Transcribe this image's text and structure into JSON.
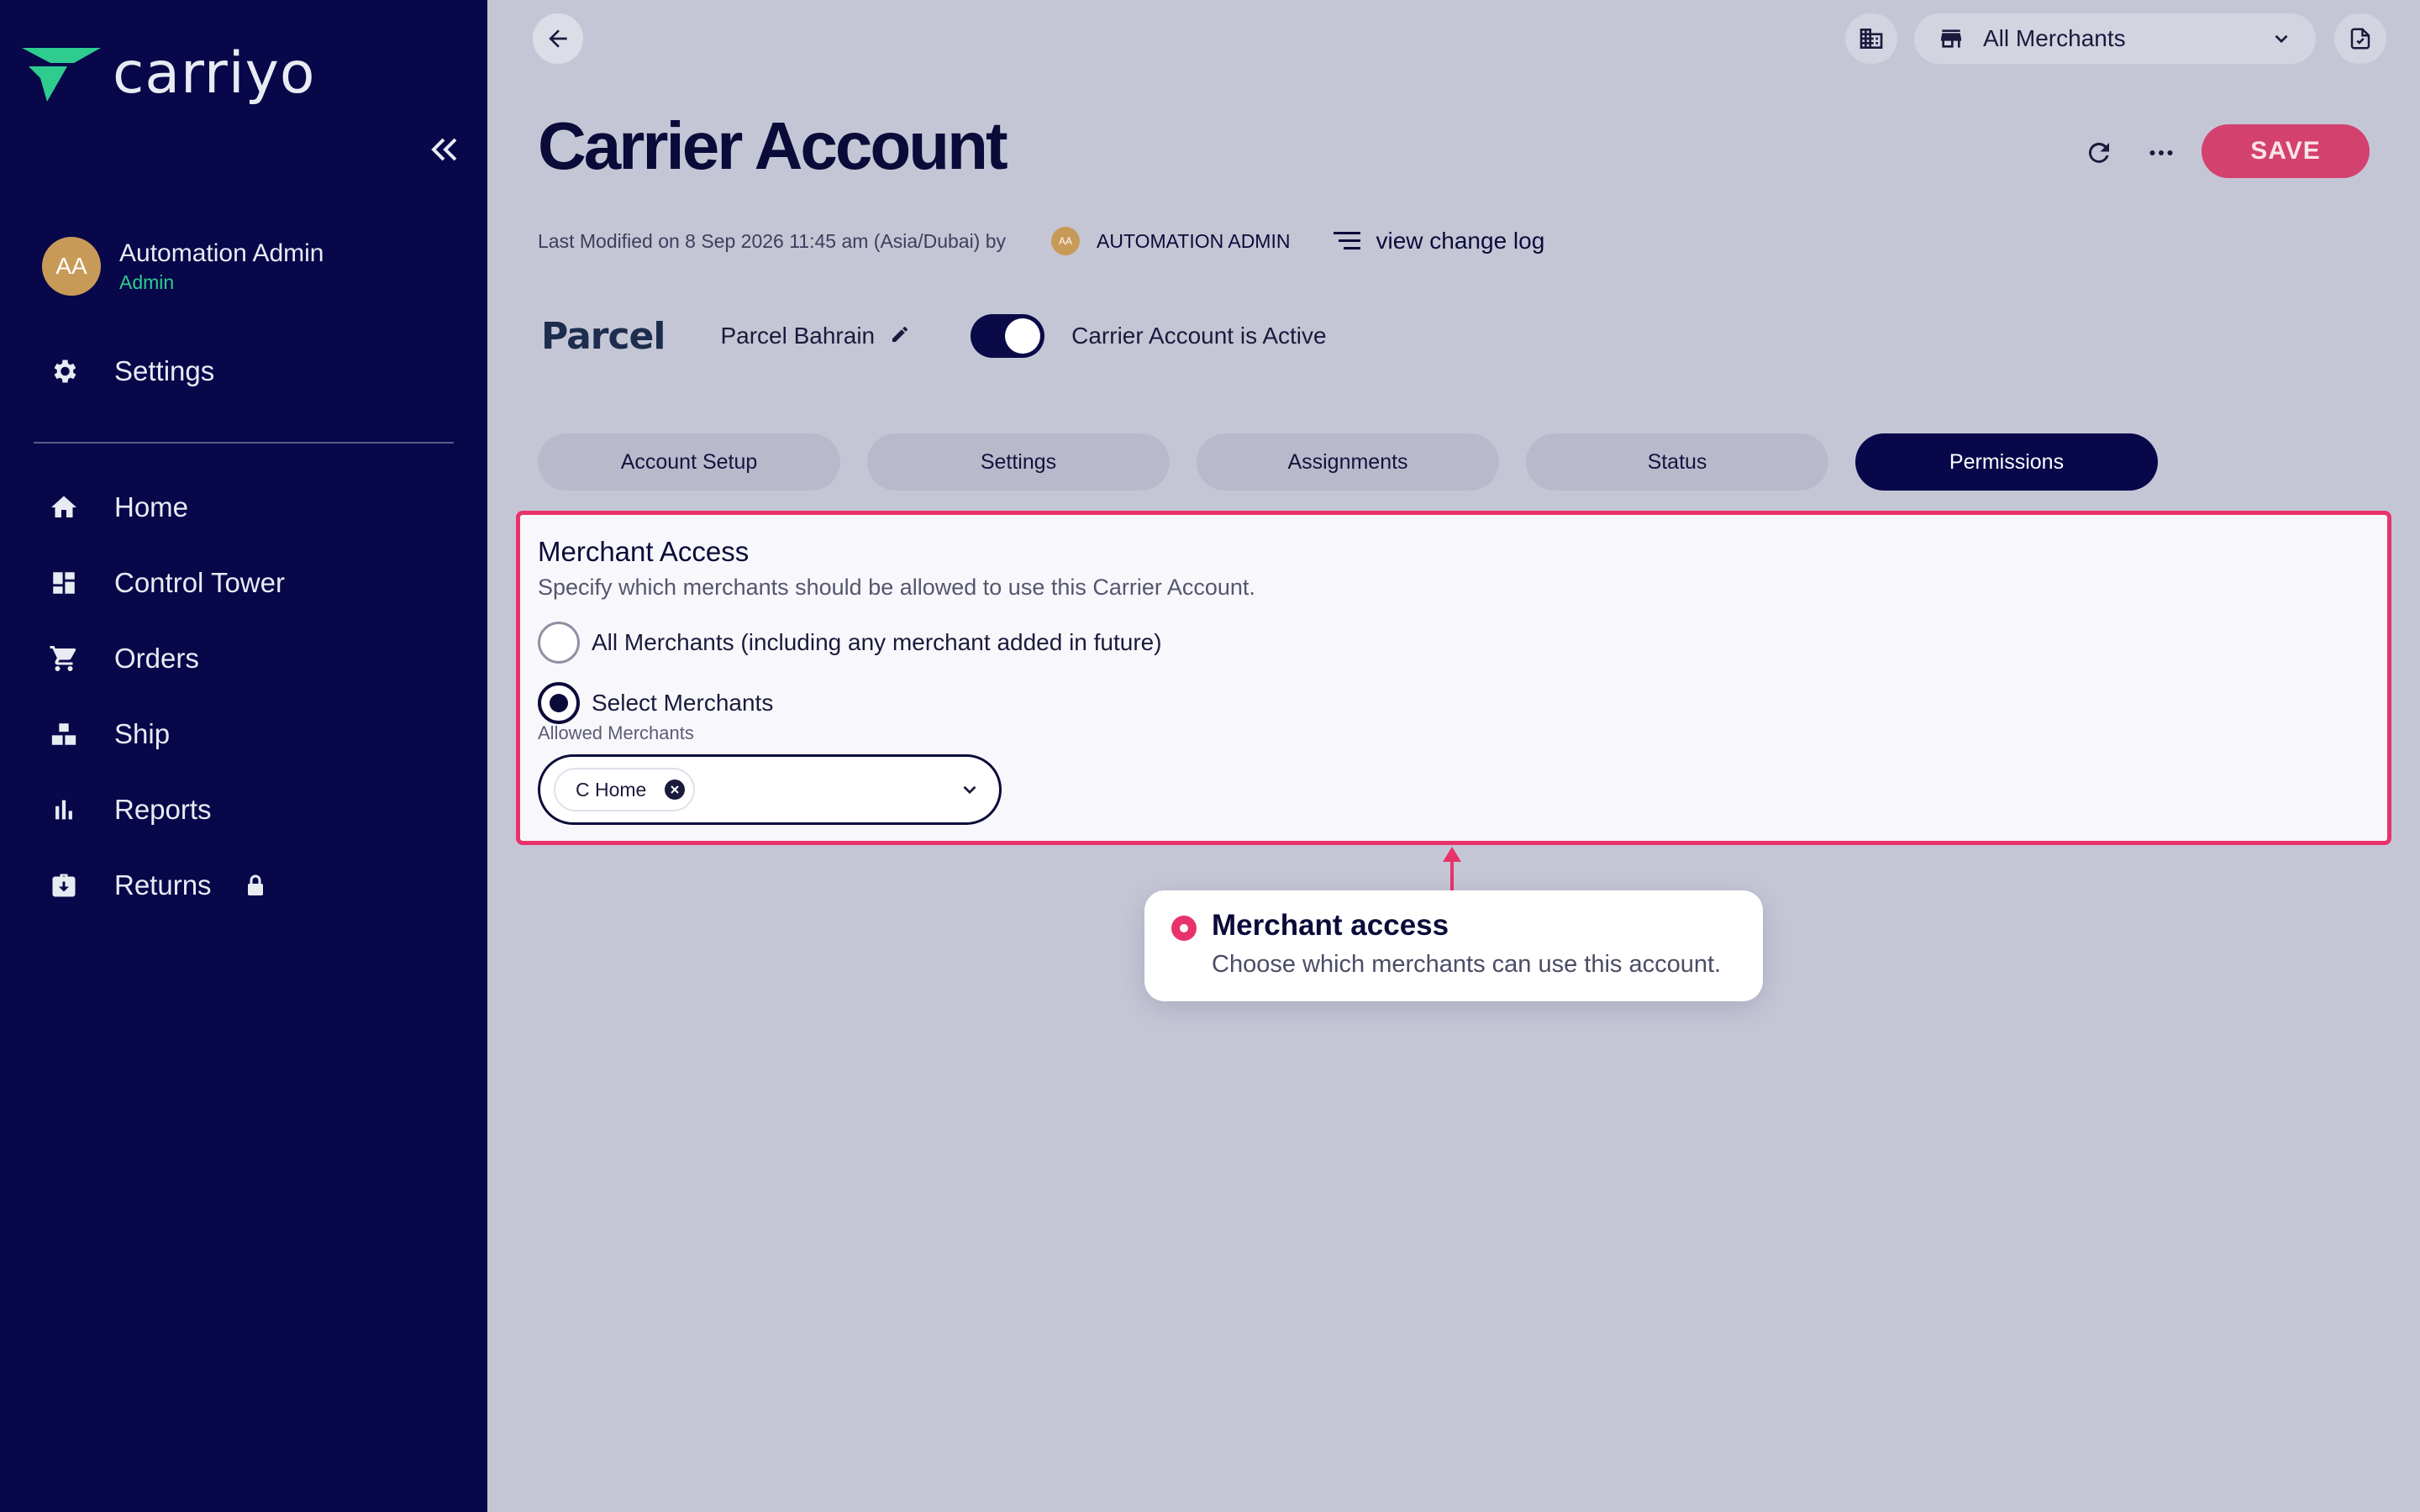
{
  "app": {
    "logo_text": "carriyo"
  },
  "user": {
    "initials": "AA",
    "name": "Automation Admin",
    "role": "Admin"
  },
  "sidebar": {
    "settings_label": "Settings",
    "items": [
      {
        "label": "Home",
        "icon": "home-icon"
      },
      {
        "label": "Control Tower",
        "icon": "dashboard-icon"
      },
      {
        "label": "Orders",
        "icon": "cart-icon"
      },
      {
        "label": "Ship",
        "icon": "ship-icon"
      },
      {
        "label": "Reports",
        "icon": "bar-chart-icon"
      },
      {
        "label": "Returns",
        "icon": "returns-icon",
        "locked": true
      }
    ]
  },
  "topbar": {
    "merchant_selector": "All Merchants"
  },
  "header": {
    "title": "Carrier Account",
    "save_label": "SAVE",
    "last_modified": "Last Modified on 8 Sep 2026 11:45 am (Asia/Dubai) by",
    "modifier_initials": "AA",
    "modifier_name": "AUTOMATION ADMIN",
    "change_log_label": "view change log"
  },
  "carrier": {
    "logo_text": "Parcel",
    "name": "Parcel Bahrain",
    "active_label": "Carrier Account is Active",
    "active": true
  },
  "tabs": [
    {
      "label": "Account Setup"
    },
    {
      "label": "Settings"
    },
    {
      "label": "Assignments"
    },
    {
      "label": "Status"
    },
    {
      "label": "Permissions",
      "active": true
    }
  ],
  "merchant_access": {
    "title": "Merchant Access",
    "subtitle": "Specify which merchants should be allowed to use this Carrier Account.",
    "option_all": "All Merchants (including any merchant added in future)",
    "option_select": "Select Merchants",
    "selected_option": "Select Merchants",
    "allowed_label": "Allowed Merchants",
    "allowed_merchants": [
      "C Home"
    ]
  },
  "callout": {
    "title": "Merchant access",
    "body": "Choose which merchants can use this account."
  },
  "colors": {
    "sidebar_bg": "#07074a",
    "accent": "#e8336a",
    "save_button": "#d3416f",
    "active_tab": "#07074a",
    "background": "#c5c6d5"
  }
}
